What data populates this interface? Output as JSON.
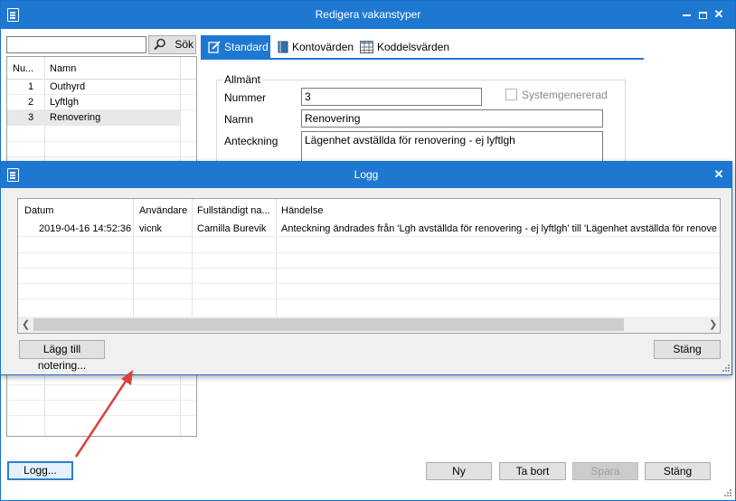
{
  "main_window": {
    "title": "Redigera vakanstyper",
    "search": {
      "value": "",
      "button_label": "Sök"
    },
    "list": {
      "headers": [
        "Nu...",
        "Namn"
      ],
      "rows": [
        {
          "num": "1",
          "name": "Outhyrd"
        },
        {
          "num": "2",
          "name": "Lyftlgh"
        },
        {
          "num": "3",
          "name": "Renovering"
        }
      ]
    },
    "tabs": [
      {
        "label": "Standard",
        "icon": "pencil-form-icon"
      },
      {
        "label": "Kontovärden",
        "icon": "book-icon"
      },
      {
        "label": "Koddelsvärden",
        "icon": "table-icon"
      }
    ],
    "form": {
      "group_label": "Allmänt",
      "nummer_label": "Nummer",
      "nummer_value": "3",
      "namn_label": "Namn",
      "namn_value": "Renovering",
      "anteckning_label": "Anteckning",
      "anteckning_value": "Lägenhet avställda för renovering - ej lyftlgh",
      "systemgenererad_label": "Systemgenererad"
    },
    "buttons": {
      "logg": "Logg...",
      "ny": "Ny",
      "ta_bort": "Ta bort",
      "spara": "Spara",
      "stang": "Stäng"
    }
  },
  "log_window": {
    "title": "Logg",
    "headers": [
      "Datum",
      "Användare",
      "Fullständigt na...",
      "Händelse"
    ],
    "rows": [
      {
        "datum": "2019-04-16 14:52:36",
        "anvandare": "vicnk",
        "namn": "Camilla Burevik",
        "handelse": "Anteckning ändrades från 'Lgh avställda för renovering - ej lyftlgh' till 'Lägenhet avställda för renoveri..."
      }
    ],
    "buttons": {
      "add_note": "Lägg till notering...",
      "close": "Stäng"
    }
  },
  "colors": {
    "titlebar": "#1e78d2",
    "annotation_arrow": "#d9413a",
    "selected_row": "#e8e8e8"
  }
}
